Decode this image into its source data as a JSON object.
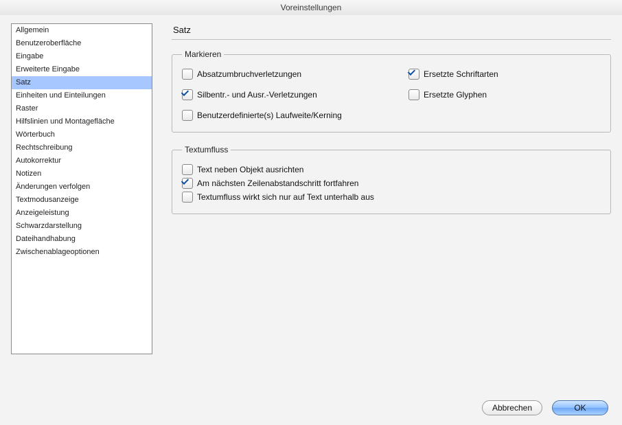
{
  "window": {
    "title": "Voreinstellungen"
  },
  "sidebar": {
    "items": [
      {
        "label": "Allgemein",
        "selected": false
      },
      {
        "label": "Benutzeroberfläche",
        "selected": false
      },
      {
        "label": "Eingabe",
        "selected": false
      },
      {
        "label": "Erweiterte Eingabe",
        "selected": false
      },
      {
        "label": "Satz",
        "selected": true
      },
      {
        "label": "Einheiten und Einteilungen",
        "selected": false
      },
      {
        "label": "Raster",
        "selected": false
      },
      {
        "label": "Hilfslinien und Montagefläche",
        "selected": false
      },
      {
        "label": "Wörterbuch",
        "selected": false
      },
      {
        "label": "Rechtschreibung",
        "selected": false
      },
      {
        "label": "Autokorrektur",
        "selected": false
      },
      {
        "label": "Notizen",
        "selected": false
      },
      {
        "label": "Änderungen verfolgen",
        "selected": false
      },
      {
        "label": "Textmodusanzeige",
        "selected": false
      },
      {
        "label": "Anzeigeleistung",
        "selected": false
      },
      {
        "label": "Schwarzdarstellung",
        "selected": false
      },
      {
        "label": "Dateihandhabung",
        "selected": false
      },
      {
        "label": "Zwischenablageoptionen",
        "selected": false
      }
    ]
  },
  "main": {
    "title": "Satz",
    "group_markieren": {
      "legend": "Markieren",
      "absatz": {
        "label": "Absatzumbruchverletzungen",
        "checked": false
      },
      "ersetzte_schrift": {
        "label": "Ersetzte Schriftarten",
        "checked": true
      },
      "silbentr": {
        "label": "Silbentr.- und Ausr.-Verletzungen",
        "checked": true
      },
      "ersetzte_glyphen": {
        "label": "Ersetzte Glyphen",
        "checked": false
      },
      "laufweite": {
        "label": "Benutzerdefinierte(s) Laufweite/Kerning",
        "checked": false
      }
    },
    "group_textumfluss": {
      "legend": "Textumfluss",
      "neben_objekt": {
        "label": "Text neben Objekt ausrichten",
        "checked": false
      },
      "zeilenabstand": {
        "label": "Am nächsten Zeilenabstandschritt fortfahren",
        "checked": true
      },
      "unterhalb": {
        "label": "Textumfluss wirkt sich nur auf Text unterhalb aus",
        "checked": false
      }
    }
  },
  "footer": {
    "cancel": "Abbrechen",
    "ok": "OK"
  }
}
